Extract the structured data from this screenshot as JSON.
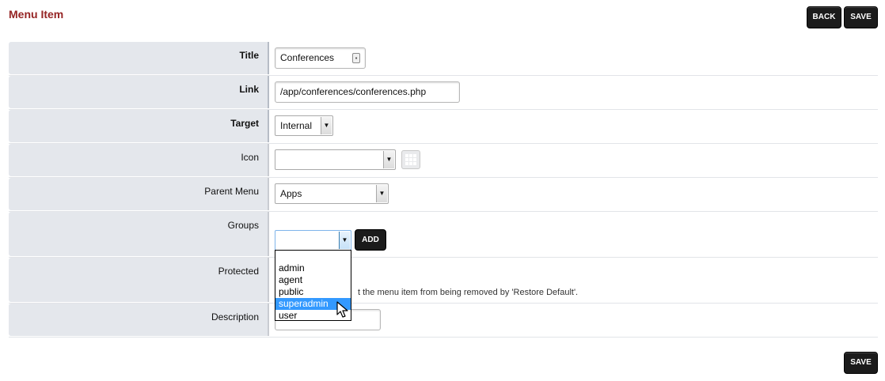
{
  "page": {
    "title": "Menu Item"
  },
  "buttons": {
    "back": "BACK",
    "save": "SAVE",
    "add": "ADD"
  },
  "fields": {
    "title": {
      "label": "Title",
      "value": "Conferences"
    },
    "link": {
      "label": "Link",
      "value": "/app/conferences/conferences.php"
    },
    "target": {
      "label": "Target",
      "value": "Internal"
    },
    "icon": {
      "label": "Icon",
      "value": ""
    },
    "parent_menu": {
      "label": "Parent Menu",
      "value": "Apps"
    },
    "groups": {
      "label": "Groups",
      "value": ""
    },
    "protected": {
      "label": "Protected",
      "hint": "t the menu item from being removed by 'Restore Default'."
    },
    "description": {
      "label": "Description",
      "value": ""
    }
  },
  "groups_dropdown": {
    "options": [
      "admin",
      "agent",
      "public",
      "superadmin",
      "user"
    ],
    "highlighted": "superadmin"
  },
  "colors": {
    "title": "#952424",
    "label_bg": "#e4e7ec",
    "button_bg": "#1b1b1b",
    "highlight": "#3399ff"
  }
}
